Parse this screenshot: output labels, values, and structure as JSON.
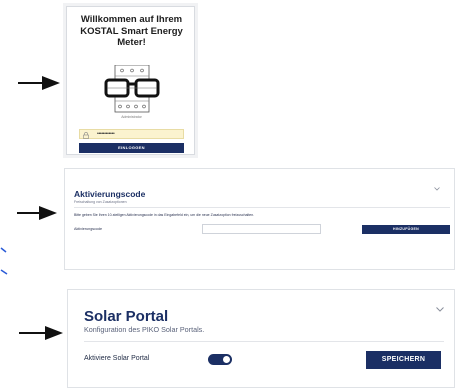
{
  "login": {
    "title": "Willkommen auf Ihrem KOSTAL Smart Energy Meter!",
    "admin_label": "Administrator",
    "password_value": "••••••••••••",
    "login_button": "EINLOGGEN"
  },
  "activation": {
    "title": "Aktivierungscode",
    "subtitle": "Freischaltung von Zusatzoptionen",
    "hint": "Bitte geben Sie Ihren 10-stelligen Aktivierungscode in das Eingabefeld ein, um die neue Zusatzoption freizuschalten.",
    "field_label": "Aktivierungscode",
    "field_value": "",
    "button": "HINZUFÜGEN"
  },
  "solar": {
    "title": "Solar Portal",
    "subtitle": "Konfiguration des PIKO Solar Portals.",
    "toggle_label": "Aktiviere Solar Portal",
    "toggle_state": "on",
    "button": "SPEICHERN"
  },
  "colors": {
    "brand_navy": "#1b2f64",
    "password_fill": "#fbf3cf"
  },
  "icons": [
    "arrow-right-icon",
    "smart-meter-icon",
    "lock-icon",
    "chevron-down-icon"
  ]
}
